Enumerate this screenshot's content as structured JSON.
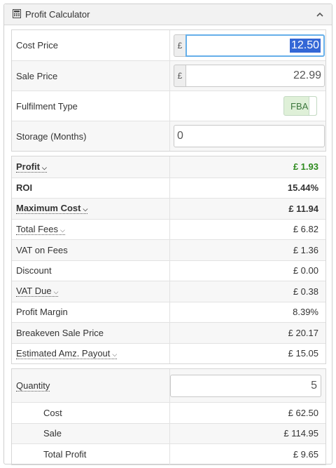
{
  "header": {
    "title": "Profit Calculator",
    "icon": "calculator-icon",
    "collapse_icon": "chevron-up-icon"
  },
  "inputs": {
    "cost_price": {
      "label": "Cost Price",
      "currency": "£",
      "value": "12.50"
    },
    "sale_price": {
      "label": "Sale Price",
      "currency": "£",
      "value": "22.99"
    },
    "fulfilment_type": {
      "label": "Fulfilment Type",
      "value": "FBA"
    },
    "storage": {
      "label": "Storage (Months)",
      "value": "0"
    }
  },
  "results": {
    "profit": {
      "label": "Profit",
      "value": "£ 1.93"
    },
    "roi": {
      "label": "ROI",
      "value": "15.44%"
    },
    "max_cost": {
      "label": "Maximum Cost",
      "value": "£ 11.94"
    },
    "total_fees": {
      "label": "Total Fees",
      "value": "£ 6.82"
    },
    "vat_fees": {
      "label": "VAT on Fees",
      "value": "£ 1.36"
    },
    "discount": {
      "label": "Discount",
      "value": "£ 0.00"
    },
    "vat_due": {
      "label": "VAT Due",
      "value": "£ 0.38"
    },
    "profit_margin": {
      "label": "Profit Margin",
      "value": "8.39%"
    },
    "breakeven": {
      "label": "Breakeven Sale Price",
      "value": "£ 20.17"
    },
    "payout": {
      "label": "Estimated Amz. Payout",
      "value": "£ 15.05"
    }
  },
  "quantity": {
    "label": "Quantity",
    "value": "5",
    "cost": {
      "label": "Cost",
      "value": "£ 62.50"
    },
    "sale": {
      "label": "Sale",
      "value": "£ 114.95"
    },
    "total_profit": {
      "label": "Total Profit",
      "value": "£ 9.65"
    }
  },
  "colors": {
    "profit_green": "#2e8b1e",
    "focus_blue": "#66afe9",
    "fba_bg": "#dff0d8"
  },
  "caret_glyph": "⌵"
}
